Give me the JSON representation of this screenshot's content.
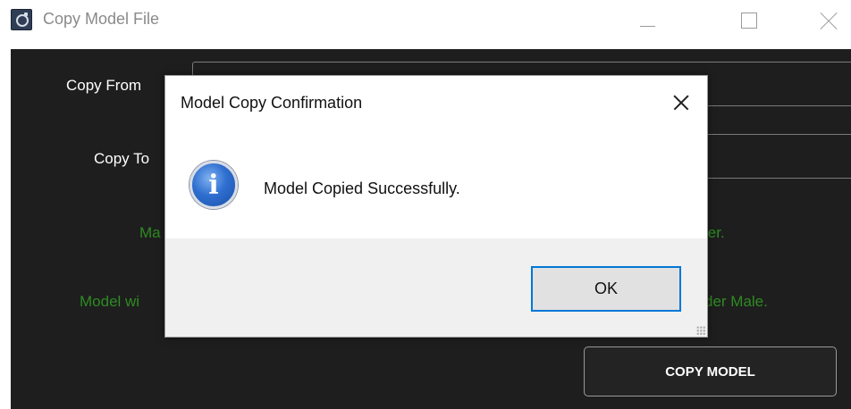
{
  "window": {
    "title": "Copy Model File",
    "app_icon": "app-icon"
  },
  "form": {
    "copy_from_label": "Copy From",
    "copy_to_label": "Copy To",
    "note1_left": "Ma",
    "note1_right": "ler.",
    "note2_left": "Model wi",
    "note2_right": "der Male.",
    "copy_button": "COPY MODEL",
    "status_color": "#2e8b22"
  },
  "dialog": {
    "title": "Model Copy Confirmation",
    "icon": "info-icon",
    "icon_glyph": "i",
    "message": "Model Copied Successfully.",
    "ok_label": "OK",
    "accent_color": "#0078d7"
  }
}
